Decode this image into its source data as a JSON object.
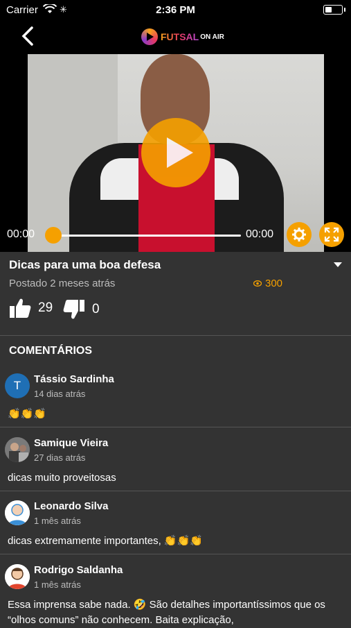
{
  "status_bar": {
    "carrier": "Carrier",
    "time": "2:36 PM"
  },
  "nav": {
    "logo_main": "FUTSAL",
    "logo_sub": "ON AIR"
  },
  "player": {
    "current_time": "00:00",
    "duration": "00:00",
    "progress": 0
  },
  "video": {
    "title": "Dicas para uma boa defesa",
    "posted": "Postado 2 meses atrás",
    "views": "300",
    "likes": "29",
    "dislikes": "0"
  },
  "comments_header": "COMENTÁRIOS",
  "comments": [
    {
      "name": "Tássio Sardinha",
      "date": "14 dias atrás",
      "text": "👏👏👏",
      "avatar_letter": "T"
    },
    {
      "name": "Samique Vieira",
      "date": "27 dias atrás",
      "text": "dicas muito proveitosas"
    },
    {
      "name": "Leonardo Silva",
      "date": "1 mês atrás",
      "text": "dicas extremamente importantes, 👏👏👏"
    },
    {
      "name": "Rodrigo Saldanha",
      "date": "1 mês atrás",
      "text": "Essa imprensa sabe nada. 🤣 São detalhes importantíssimos que os “olhos comuns” não conhecem. Baita explicação,"
    }
  ],
  "colors": {
    "accent": "#f5a000",
    "background": "#333333",
    "bar": "#000000"
  }
}
